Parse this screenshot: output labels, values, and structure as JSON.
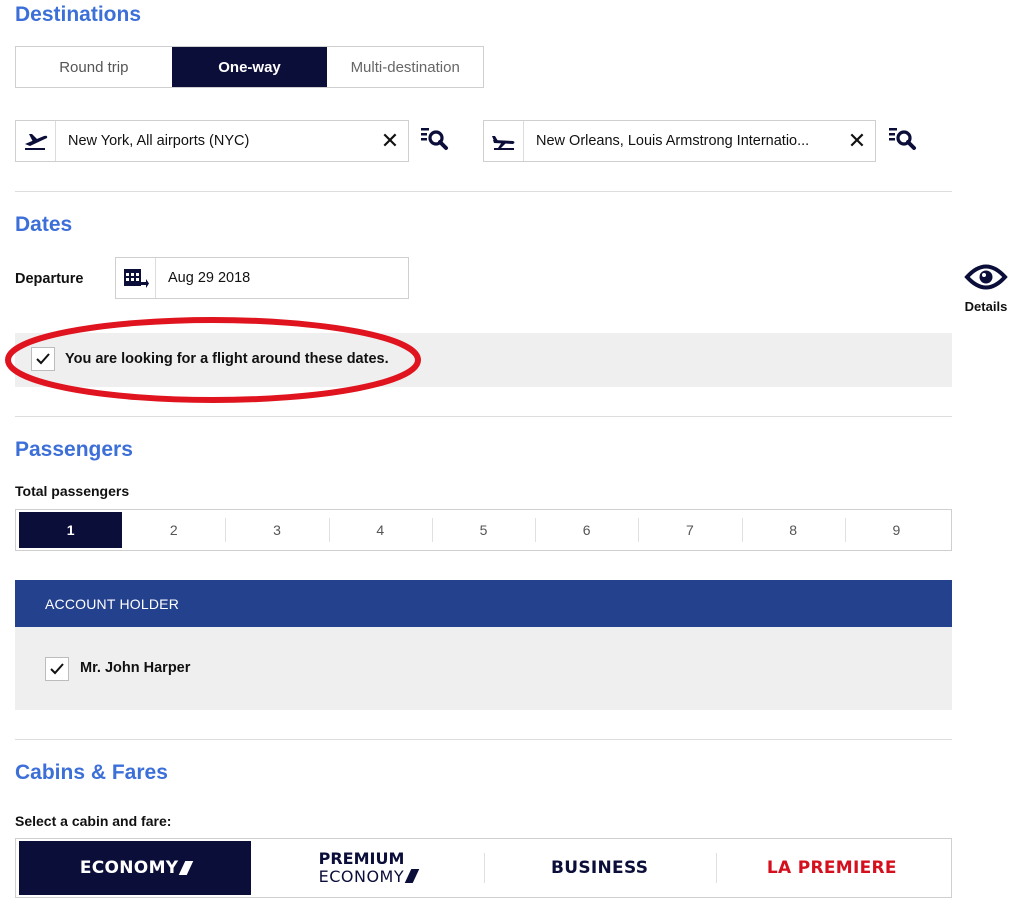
{
  "destinations": {
    "title": "Destinations",
    "trip_types": [
      "Round trip",
      "One-way",
      "Multi-destination"
    ],
    "active_trip_type": "One-way",
    "origin": "New York, All airports (NYC)",
    "destination": "New Orleans, Louis Armstrong Internatio...",
    "clear_symbol": "✕"
  },
  "dates": {
    "title": "Dates",
    "departure_label": "Departure",
    "departure_value": "Aug 29 2018",
    "flexible_text": "You are looking for a flight around these dates.",
    "flexible_checked": true
  },
  "details": {
    "label": "Details",
    "icon": "eye-icon"
  },
  "passengers": {
    "title": "Passengers",
    "total_label": "Total passengers",
    "options": [
      "1",
      "2",
      "3",
      "4",
      "5",
      "6",
      "7",
      "8",
      "9"
    ],
    "selected": "1",
    "account_header": "ACCOUNT HOLDER",
    "account_name": "Mr. John Harper",
    "account_checked": true
  },
  "cabins": {
    "title": "Cabins & Fares",
    "select_label": "Select a cabin and fare:",
    "economy": "ECONOMY",
    "premium_line1": "PREMIUM",
    "premium_line2": "ECONOMY",
    "business": "BUSINESS",
    "premiere": "LA PREMIERE",
    "selected": "ECONOMY"
  },
  "colors": {
    "heading": "#3c6fd8",
    "navy": "#0c0e3a",
    "account_header": "#24418e",
    "premiere_red": "#d5101e",
    "highlight_oval": "#e0141e"
  }
}
